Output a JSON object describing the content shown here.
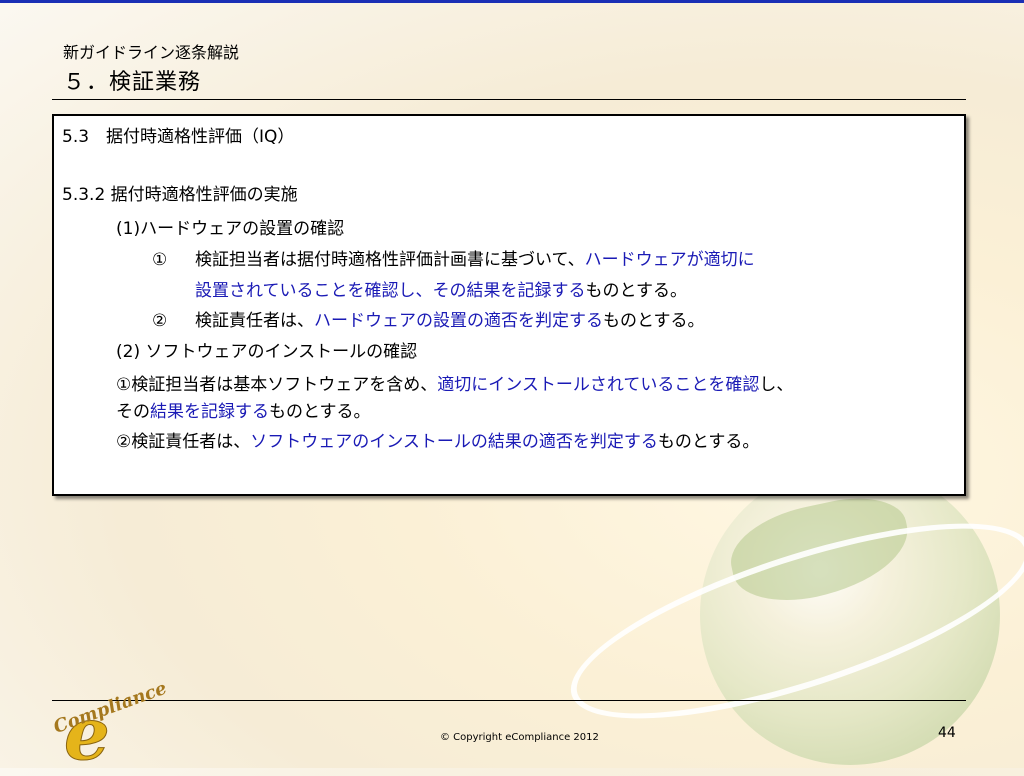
{
  "header": {
    "subtitle": "新ガイドライン逐条解説",
    "title": "５．検証業務"
  },
  "content": {
    "section_heading": "5.3　据付時適格性評価（IQ）",
    "subsection_heading": "5.3.2 据付時適格性評価の実施",
    "item1_heading": "(1)ハードウェアの設置の確認",
    "item1_point1_marker": "①",
    "item1_point1_text_a": "検証担当者は据付時適格性評価計画書に基づいて、",
    "item1_point1_emph_a": "ハードウェアが適切に",
    "item1_point1_emph_b": "設置されていることを確認し、その結果を記録する",
    "item1_point1_text_b": "ものとする。",
    "item1_point2_marker": "②",
    "item1_point2_text_a": "検証責任者は、",
    "item1_point2_emph": "ハードウェアの設置の適否を判定する",
    "item1_point2_text_b": "ものとする。",
    "item2_heading": "(2) ソフトウェアのインストールの確認",
    "item2_point1_text_a": "①検証担当者は基本ソフトウェアを含め、",
    "item2_point1_emph_a": "適切にインストールされていることを確認",
    "item2_point1_text_b": "し、",
    "item2_point1_text_c": "その",
    "item2_point1_emph_b": "結果を記録する",
    "item2_point1_text_d": "ものとする。",
    "item2_point2_text_a": "②検証責任者は、",
    "item2_point2_emph": "ソフトウェアのインストールの結果の適否を判定する",
    "item2_point2_text_b": "ものとする。"
  },
  "footer": {
    "copyright": "© Copyright eCompliance 2012",
    "page_number": "44",
    "logo_letter": "e",
    "logo_text": "Compliance"
  },
  "colors": {
    "emphasis": "#1a1ab5",
    "top_bar": "#1a2fb5"
  }
}
